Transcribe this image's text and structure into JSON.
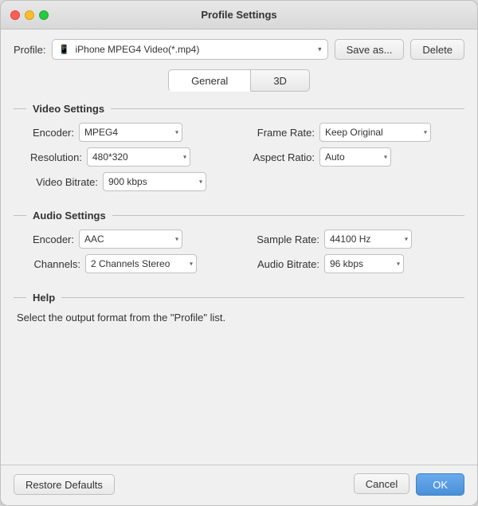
{
  "window": {
    "title": "Profile Settings"
  },
  "profile_row": {
    "label": "Profile:",
    "selected": "iPhone MPEG4 Video(*.mp4)",
    "phone_icon": "📱",
    "save_as_label": "Save as...",
    "delete_label": "Delete"
  },
  "tabs": {
    "general_label": "General",
    "three_d_label": "3D"
  },
  "video_settings": {
    "title": "Video Settings",
    "encoder_label": "Encoder:",
    "encoder_value": "MPEG4",
    "frame_rate_label": "Frame Rate:",
    "frame_rate_value": "Keep Original",
    "resolution_label": "Resolution:",
    "resolution_value": "480*320",
    "aspect_ratio_label": "Aspect Ratio:",
    "aspect_ratio_value": "Auto",
    "video_bitrate_label": "Video Bitrate:",
    "video_bitrate_value": "900 kbps"
  },
  "audio_settings": {
    "title": "Audio Settings",
    "encoder_label": "Encoder:",
    "encoder_value": "AAC",
    "sample_rate_label": "Sample Rate:",
    "sample_rate_value": "44100 Hz",
    "channels_label": "Channels:",
    "channels_value": "2 Channels Stereo",
    "audio_bitrate_label": "Audio Bitrate:",
    "audio_bitrate_value": "96 kbps"
  },
  "help": {
    "title": "Help",
    "text": "Select the output format from the \"Profile\" list."
  },
  "footer": {
    "restore_label": "Restore Defaults",
    "cancel_label": "Cancel",
    "ok_label": "OK"
  }
}
